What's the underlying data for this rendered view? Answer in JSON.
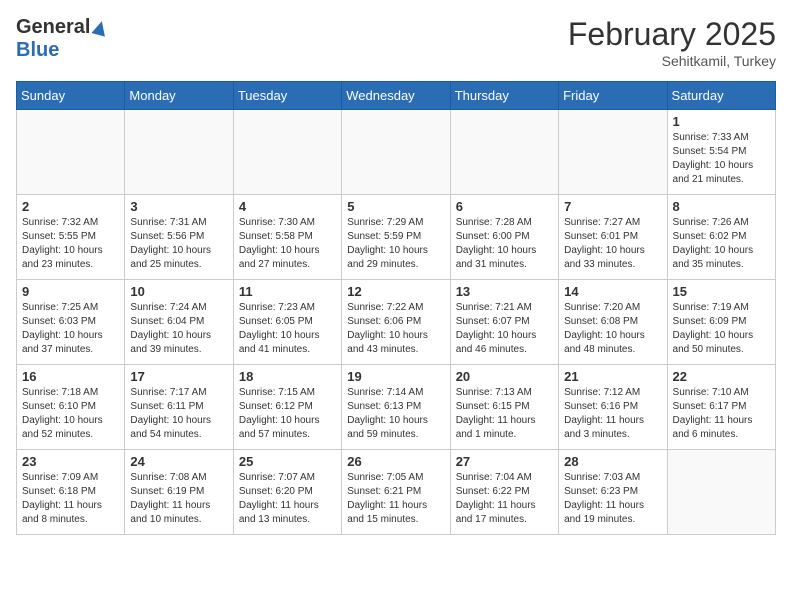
{
  "header": {
    "logo_general": "General",
    "logo_blue": "Blue",
    "month_year": "February 2025",
    "location": "Sehitkamil, Turkey"
  },
  "weekdays": [
    "Sunday",
    "Monday",
    "Tuesday",
    "Wednesday",
    "Thursday",
    "Friday",
    "Saturday"
  ],
  "weeks": [
    [
      {
        "day": "",
        "info": ""
      },
      {
        "day": "",
        "info": ""
      },
      {
        "day": "",
        "info": ""
      },
      {
        "day": "",
        "info": ""
      },
      {
        "day": "",
        "info": ""
      },
      {
        "day": "",
        "info": ""
      },
      {
        "day": "1",
        "info": "Sunrise: 7:33 AM\nSunset: 5:54 PM\nDaylight: 10 hours and 21 minutes."
      }
    ],
    [
      {
        "day": "2",
        "info": "Sunrise: 7:32 AM\nSunset: 5:55 PM\nDaylight: 10 hours and 23 minutes."
      },
      {
        "day": "3",
        "info": "Sunrise: 7:31 AM\nSunset: 5:56 PM\nDaylight: 10 hours and 25 minutes."
      },
      {
        "day": "4",
        "info": "Sunrise: 7:30 AM\nSunset: 5:58 PM\nDaylight: 10 hours and 27 minutes."
      },
      {
        "day": "5",
        "info": "Sunrise: 7:29 AM\nSunset: 5:59 PM\nDaylight: 10 hours and 29 minutes."
      },
      {
        "day": "6",
        "info": "Sunrise: 7:28 AM\nSunset: 6:00 PM\nDaylight: 10 hours and 31 minutes."
      },
      {
        "day": "7",
        "info": "Sunrise: 7:27 AM\nSunset: 6:01 PM\nDaylight: 10 hours and 33 minutes."
      },
      {
        "day": "8",
        "info": "Sunrise: 7:26 AM\nSunset: 6:02 PM\nDaylight: 10 hours and 35 minutes."
      }
    ],
    [
      {
        "day": "9",
        "info": "Sunrise: 7:25 AM\nSunset: 6:03 PM\nDaylight: 10 hours and 37 minutes."
      },
      {
        "day": "10",
        "info": "Sunrise: 7:24 AM\nSunset: 6:04 PM\nDaylight: 10 hours and 39 minutes."
      },
      {
        "day": "11",
        "info": "Sunrise: 7:23 AM\nSunset: 6:05 PM\nDaylight: 10 hours and 41 minutes."
      },
      {
        "day": "12",
        "info": "Sunrise: 7:22 AM\nSunset: 6:06 PM\nDaylight: 10 hours and 43 minutes."
      },
      {
        "day": "13",
        "info": "Sunrise: 7:21 AM\nSunset: 6:07 PM\nDaylight: 10 hours and 46 minutes."
      },
      {
        "day": "14",
        "info": "Sunrise: 7:20 AM\nSunset: 6:08 PM\nDaylight: 10 hours and 48 minutes."
      },
      {
        "day": "15",
        "info": "Sunrise: 7:19 AM\nSunset: 6:09 PM\nDaylight: 10 hours and 50 minutes."
      }
    ],
    [
      {
        "day": "16",
        "info": "Sunrise: 7:18 AM\nSunset: 6:10 PM\nDaylight: 10 hours and 52 minutes."
      },
      {
        "day": "17",
        "info": "Sunrise: 7:17 AM\nSunset: 6:11 PM\nDaylight: 10 hours and 54 minutes."
      },
      {
        "day": "18",
        "info": "Sunrise: 7:15 AM\nSunset: 6:12 PM\nDaylight: 10 hours and 57 minutes."
      },
      {
        "day": "19",
        "info": "Sunrise: 7:14 AM\nSunset: 6:13 PM\nDaylight: 10 hours and 59 minutes."
      },
      {
        "day": "20",
        "info": "Sunrise: 7:13 AM\nSunset: 6:15 PM\nDaylight: 11 hours and 1 minute."
      },
      {
        "day": "21",
        "info": "Sunrise: 7:12 AM\nSunset: 6:16 PM\nDaylight: 11 hours and 3 minutes."
      },
      {
        "day": "22",
        "info": "Sunrise: 7:10 AM\nSunset: 6:17 PM\nDaylight: 11 hours and 6 minutes."
      }
    ],
    [
      {
        "day": "23",
        "info": "Sunrise: 7:09 AM\nSunset: 6:18 PM\nDaylight: 11 hours and 8 minutes."
      },
      {
        "day": "24",
        "info": "Sunrise: 7:08 AM\nSunset: 6:19 PM\nDaylight: 11 hours and 10 minutes."
      },
      {
        "day": "25",
        "info": "Sunrise: 7:07 AM\nSunset: 6:20 PM\nDaylight: 11 hours and 13 minutes."
      },
      {
        "day": "26",
        "info": "Sunrise: 7:05 AM\nSunset: 6:21 PM\nDaylight: 11 hours and 15 minutes."
      },
      {
        "day": "27",
        "info": "Sunrise: 7:04 AM\nSunset: 6:22 PM\nDaylight: 11 hours and 17 minutes."
      },
      {
        "day": "28",
        "info": "Sunrise: 7:03 AM\nSunset: 6:23 PM\nDaylight: 11 hours and 19 minutes."
      },
      {
        "day": "",
        "info": ""
      }
    ]
  ]
}
